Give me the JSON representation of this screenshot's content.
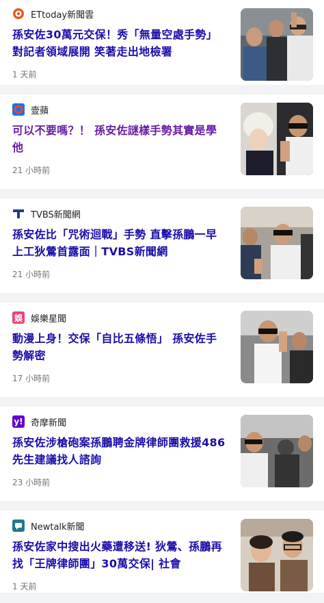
{
  "articles": [
    {
      "source": "ETtoday新聞雲",
      "icon": "ettoday-icon",
      "icon_color": "#e8582a",
      "headline": "孫安佐30萬元交保！秀「無量空處手勢」對記者領域展開 笑著走出地檢署",
      "time": "1 天前",
      "visited": false
    },
    {
      "source": "壹蘋",
      "icon": "nextapple-icon",
      "icon_color": "#d93025",
      "headline": "可以不要嗎？！ 孫安佐謎樣手勢其實是學他",
      "time": "21 小時前",
      "visited": true
    },
    {
      "source": "TVBS新聞網",
      "icon": "tvbs-icon",
      "icon_color": "#1d3f8a",
      "headline": "孫安佐比「咒術迴戰」手勢 直擊孫鵬一早上工狄鶯首露面｜TVBS新聞網",
      "time": "21 小時前",
      "visited": false
    },
    {
      "source": "娛樂星聞",
      "icon": "star-news-icon",
      "icon_color": "#e8457a",
      "headline": "動漫上身！交保「自比五條悟」 孫安佐手勢解密",
      "time": "17 小時前",
      "visited": false
    },
    {
      "source": "奇摩新聞",
      "icon": "yahoo-icon",
      "icon_color": "#6001d2",
      "headline": "孫安佐涉槍砲案孫鵬聘金牌律師團救援486先生建議找人諮詢",
      "time": "23 小時前",
      "visited": false
    },
    {
      "source": "Newtalk新聞",
      "icon": "newtalk-icon",
      "icon_color": "#1f7a8c",
      "headline": "孫安佐家中搜出火藥遭移送! 狄鶯、孫鵬再找「王牌律師團」30萬交保| 社會",
      "time": "1 天前",
      "visited": false
    }
  ]
}
